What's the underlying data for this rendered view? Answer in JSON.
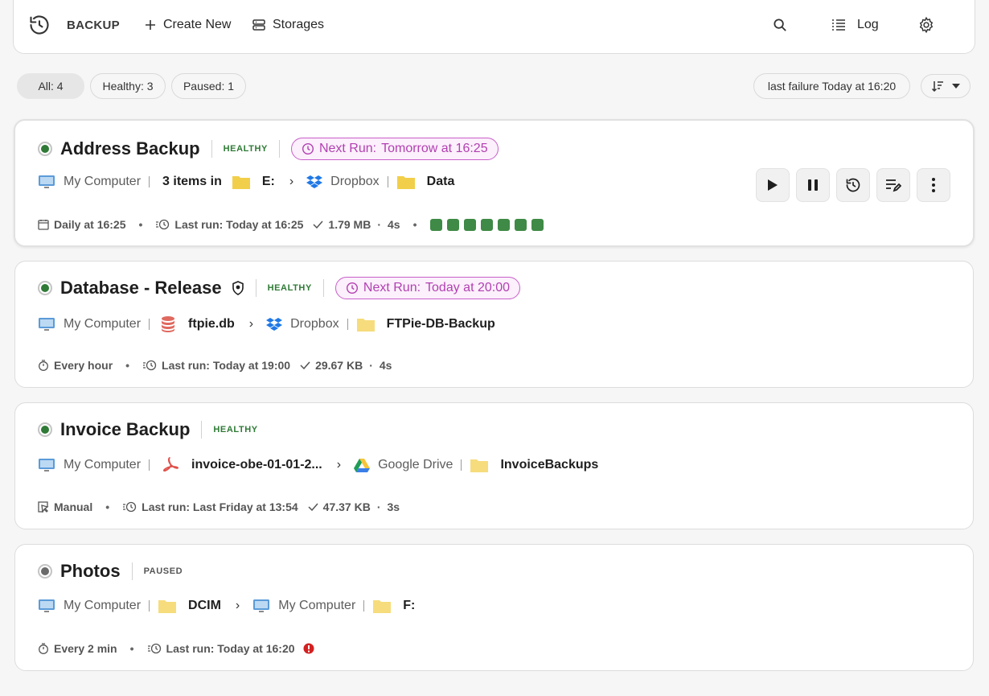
{
  "topbar": {
    "brand": "BACKUP",
    "create_new": "Create New",
    "storages": "Storages",
    "log": "Log"
  },
  "filters": {
    "all": "All: 4",
    "healthy": "Healthy: 3",
    "paused": "Paused: 1",
    "last_failure": "last failure Today at 16:20"
  },
  "colors": {
    "healthy": "#2f7a36",
    "next_run": "#b23fb2",
    "folder": "#f2cf4a",
    "error": "#d32020"
  },
  "jobs": [
    {
      "title": "Address Backup",
      "status": "HEALTHY",
      "next_run_label": "Next Run:",
      "next_run_value": "Tomorrow at 16:25",
      "source_device": "My Computer",
      "source_prefix": "3 items in",
      "source_path": "E:",
      "dest_storage": "Dropbox",
      "dest_path": "Data",
      "schedule": "Daily at 16:25",
      "last_run": "Last run: Today at 16:25",
      "size": "1.79 MB",
      "duration": "4s",
      "history_count": 7
    },
    {
      "title": "Database - Release",
      "status": "HEALTHY",
      "next_run_label": "Next Run:",
      "next_run_value": "Today at 20:00",
      "source_device": "My Computer",
      "source_path": "ftpie.db",
      "dest_storage": "Dropbox",
      "dest_path": "FTPie-DB-Backup",
      "schedule": "Every hour",
      "last_run": "Last run: Today at 19:00",
      "size": "29.67 KB",
      "duration": "4s"
    },
    {
      "title": "Invoice Backup",
      "status": "HEALTHY",
      "source_device": "My Computer",
      "source_path": "invoice-obe-01-01-2...",
      "dest_storage": "Google Drive",
      "dest_path": "InvoiceBackups",
      "schedule": "Manual",
      "last_run": "Last run: Last Friday at 13:54",
      "size": "47.37 KB",
      "duration": "3s"
    },
    {
      "title": "Photos",
      "status": "PAUSED",
      "source_device": "My Computer",
      "source_path": "DCIM",
      "dest_storage": "My Computer",
      "dest_path": "F:",
      "schedule": "Every 2 min",
      "last_run": "Last run: Today at 16:20"
    }
  ]
}
